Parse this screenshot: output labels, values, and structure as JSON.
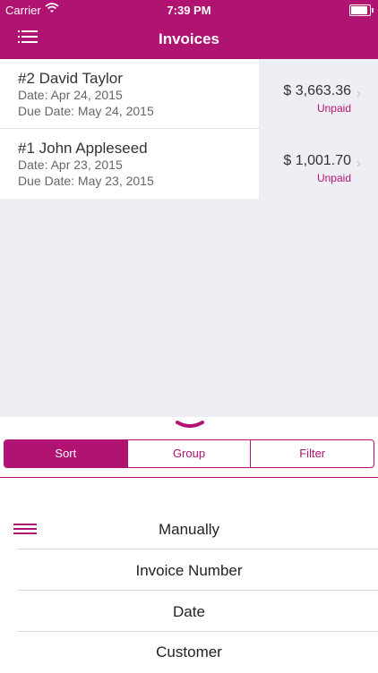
{
  "status_bar": {
    "carrier": "Carrier",
    "time": "7:39 PM"
  },
  "header": {
    "title": "Invoices"
  },
  "invoices": [
    {
      "name": "#2 David Taylor",
      "date": "Date: Apr 24, 2015",
      "due": "Due Date: May 24, 2015",
      "amount": "$ 3,663.36",
      "status": "Unpaid"
    },
    {
      "name": "#1 John Appleseed",
      "date": "Date: Apr 23, 2015",
      "due": "Due Date: May 23, 2015",
      "amount": "$ 1,001.70",
      "status": "Unpaid"
    }
  ],
  "tabs": [
    "Sort",
    "Group",
    "Filter"
  ],
  "sort_options": [
    "Manually",
    "Invoice Number",
    "Date",
    "Customer"
  ],
  "colors": {
    "accent": "#b01372",
    "background": "#efeef4"
  }
}
